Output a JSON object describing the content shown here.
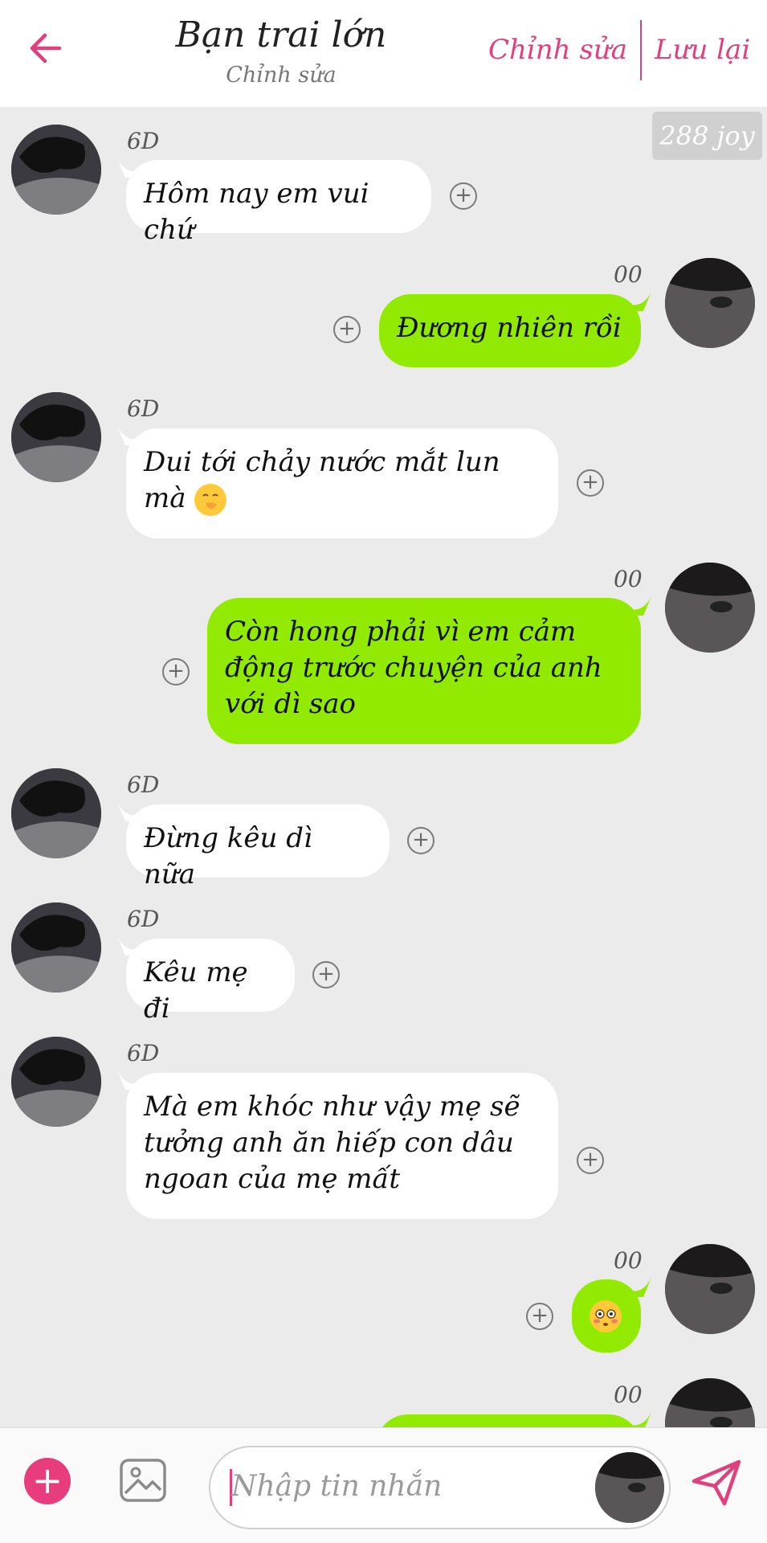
{
  "header": {
    "title": "Bạn trai lớn",
    "subtitle": "Chỉnh sửa",
    "edit_label": "Chỉnh sửa",
    "save_label": "Lưu lại"
  },
  "watermark": "288 joy",
  "messages": [
    {
      "side": "in",
      "sender": "6D",
      "text": "Hôm nay em vui chứ"
    },
    {
      "side": "out",
      "sender": "00",
      "text": "Đương nhiên rồi"
    },
    {
      "side": "in",
      "sender": "6D",
      "text": "Dui tới chảy nước mắt lun mà",
      "emoji": "hand-over-mouth-emoji"
    },
    {
      "side": "out",
      "sender": "00",
      "text": "Còn hong phải vì em cảm động trước chuyện của anh với dì sao"
    },
    {
      "side": "in",
      "sender": "6D",
      "text": "Đừng kêu dì nữa"
    },
    {
      "side": "in",
      "sender": "6D",
      "text": "Kêu mẹ đi"
    },
    {
      "side": "in",
      "sender": "6D",
      "text": "Mà em khóc như vậy mẹ sẽ tưởng anh ăn hiếp con dâu ngoan của mẹ mất"
    },
    {
      "side": "out",
      "sender": "00",
      "text": "",
      "emoji": "flushed-face-emoji"
    },
    {
      "side": "out",
      "sender": "00",
      "text": ""
    }
  ],
  "footer": {
    "input_placeholder": "Nhập tin nhắn"
  },
  "colors": {
    "accent": "#e0407e",
    "outgoing_bubble": "#91ea00",
    "incoming_bubble": "#ffffff",
    "background": "#ebebeb"
  }
}
